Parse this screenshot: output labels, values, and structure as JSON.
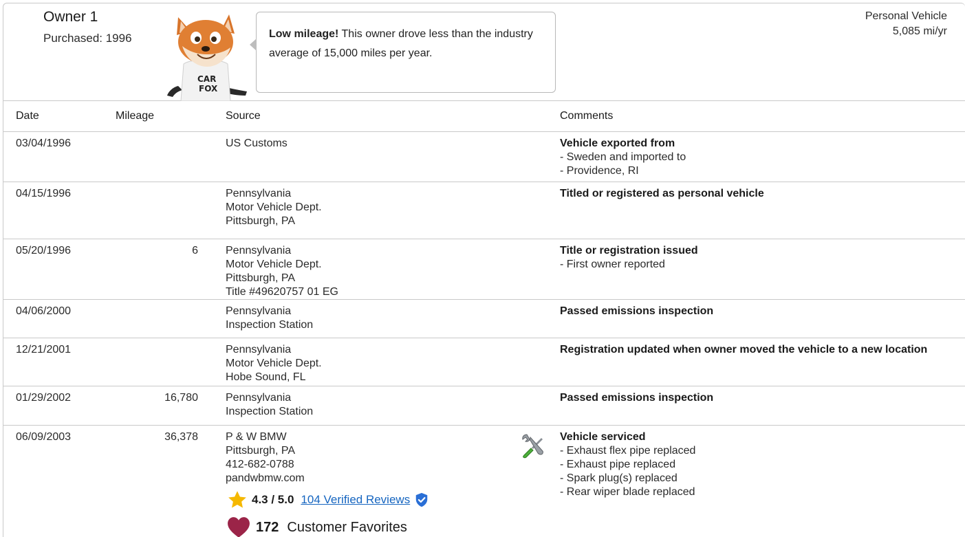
{
  "header": {
    "owner_title": "Owner 1",
    "purchased": "Purchased: 1996",
    "bubble_bold": "Low mileage!",
    "bubble_text": " This owner drove less than the industry average of 15,000 miles per year.",
    "vehicle_type": "Personal Vehicle",
    "mileage_rate": "5,085 mi/yr",
    "mascot_shirt": [
      "CAR",
      "FOX"
    ]
  },
  "columns": {
    "date": "Date",
    "mileage": "Mileage",
    "source": "Source",
    "comments": "Comments"
  },
  "rows": [
    {
      "date": "03/04/1996",
      "mileage": "",
      "source": [
        "US Customs"
      ],
      "comment_title": "Vehicle exported from",
      "comment_lines": [
        "- Sweden and imported to",
        "- Providence, RI"
      ]
    },
    {
      "date": "04/15/1996",
      "mileage": "",
      "source": [
        "Pennsylvania",
        "Motor Vehicle Dept.",
        "Pittsburgh, PA"
      ],
      "comment_title": "Titled or registered as personal vehicle",
      "comment_lines": []
    },
    {
      "date": "05/20/1996",
      "mileage": "6",
      "source": [
        "Pennsylvania",
        "Motor Vehicle Dept.",
        "Pittsburgh, PA",
        "Title #49620757 01 EG"
      ],
      "comment_title": "Title or registration issued",
      "comment_lines": [
        "- First owner reported"
      ]
    },
    {
      "date": "04/06/2000",
      "mileage": "",
      "source": [
        "Pennsylvania",
        "Inspection Station"
      ],
      "comment_title": "Passed emissions inspection",
      "comment_lines": []
    },
    {
      "date": "12/21/2001",
      "mileage": "",
      "source": [
        "Pennsylvania",
        "Motor Vehicle Dept.",
        "Hobe Sound, FL"
      ],
      "comment_title": "Registration updated when owner moved the vehicle to a new location",
      "comment_lines": []
    },
    {
      "date": "01/29/2002",
      "mileage": "16,780",
      "source": [
        "Pennsylvania",
        "Inspection Station"
      ],
      "comment_title": "Passed emissions inspection",
      "comment_lines": []
    },
    {
      "date": "06/09/2003",
      "mileage": "36,378",
      "source": [
        "P & W BMW",
        "Pittsburgh, PA",
        "412-682-0788",
        "pandwbmw.com"
      ],
      "comment_title": "Vehicle serviced",
      "comment_lines": [
        "- Exhaust flex pipe replaced",
        "- Exhaust pipe replaced",
        "- Spark plug(s) replaced",
        "- Rear wiper blade replaced"
      ],
      "icon": "tools-icon",
      "rating": {
        "score": "4.3 / 5.0",
        "reviews": "104 Verified Reviews",
        "favorites_count": "172",
        "favorites_label": "Customer Favorites"
      }
    }
  ],
  "colors": {
    "border": "#c9c9c9",
    "link": "#1565c0",
    "star": "#f5b800",
    "heart": "#9b2448",
    "verified": "#2a6fd6"
  }
}
